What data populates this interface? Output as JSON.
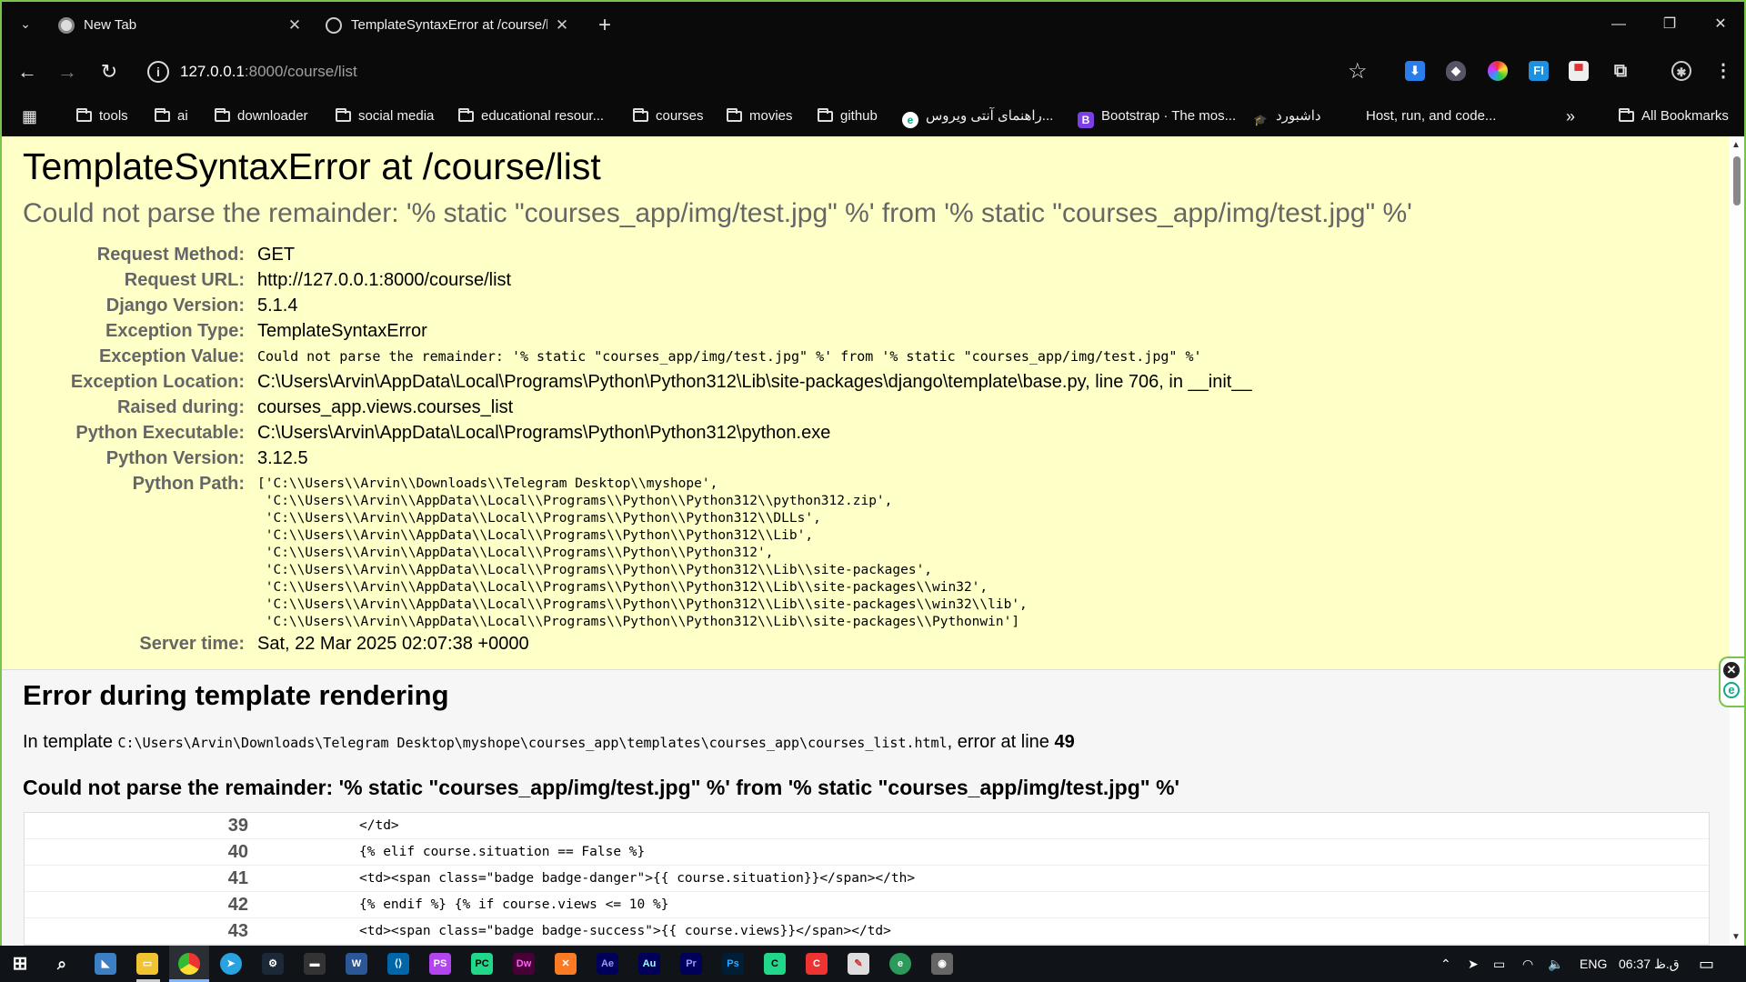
{
  "browser": {
    "tabs": [
      {
        "title": "New Tab"
      },
      {
        "title": "TemplateSyntaxError at /course/list"
      }
    ],
    "url_host": "127.0.0.1",
    "url_rest": ":8000/course/list",
    "bookmarks": [
      {
        "label": "tools",
        "type": "folder"
      },
      {
        "label": "ai",
        "type": "folder"
      },
      {
        "label": "downloader",
        "type": "folder"
      },
      {
        "label": "social media",
        "type": "folder"
      },
      {
        "label": "educational resour...",
        "type": "folder"
      },
      {
        "label": "courses",
        "type": "folder"
      },
      {
        "label": "movies",
        "type": "folder"
      },
      {
        "label": "github",
        "type": "folder"
      },
      {
        "label": "راهنمای آنتی ویروس...",
        "type": "site"
      },
      {
        "label": "Bootstrap · The mos...",
        "type": "site"
      },
      {
        "label": "داشبورد",
        "type": "site"
      },
      {
        "label": "Host, run, and code...",
        "type": "site"
      }
    ],
    "all_bookmarks": "All Bookmarks"
  },
  "error": {
    "title": "TemplateSyntaxError at /course/list",
    "subtitle": "Could not parse the remainder: '% static \"courses_app/img/test.jpg\" %' from '% static \"courses_app/img/test.jpg\" %'",
    "meta": [
      {
        "key": "Request Method:",
        "value": "GET"
      },
      {
        "key": "Request URL:",
        "value": "http://127.0.0.1:8000/course/list"
      },
      {
        "key": "Django Version:",
        "value": "5.1.4"
      },
      {
        "key": "Exception Type:",
        "value": "TemplateSyntaxError"
      },
      {
        "key": "Exception Value:",
        "value": "Could not parse the remainder: '% static \"courses_app/img/test.jpg\" %' from '% static \"courses_app/img/test.jpg\" %'"
      },
      {
        "key": "Exception Location:",
        "value": "C:\\Users\\Arvin\\AppData\\Local\\Programs\\Python\\Python312\\Lib\\site-packages\\django\\template\\base.py, line 706, in __init__"
      },
      {
        "key": "Raised during:",
        "value": "courses_app.views.courses_list"
      },
      {
        "key": "Python Executable:",
        "value": "C:\\Users\\Arvin\\AppData\\Local\\Programs\\Python\\Python312\\python.exe"
      },
      {
        "key": "Python Version:",
        "value": "3.12.5"
      }
    ],
    "python_path_label": "Python Path:",
    "python_path": [
      "['C:\\\\Users\\\\Arvin\\\\Downloads\\\\Telegram Desktop\\\\myshope',",
      " 'C:\\\\Users\\\\Arvin\\\\AppData\\\\Local\\\\Programs\\\\Python\\\\Python312\\\\python312.zip',",
      " 'C:\\\\Users\\\\Arvin\\\\AppData\\\\Local\\\\Programs\\\\Python\\\\Python312\\\\DLLs',",
      " 'C:\\\\Users\\\\Arvin\\\\AppData\\\\Local\\\\Programs\\\\Python\\\\Python312\\\\Lib',",
      " 'C:\\\\Users\\\\Arvin\\\\AppData\\\\Local\\\\Programs\\\\Python\\\\Python312',",
      " 'C:\\\\Users\\\\Arvin\\\\AppData\\\\Local\\\\Programs\\\\Python\\\\Python312\\\\Lib\\\\site-packages',",
      " 'C:\\\\Users\\\\Arvin\\\\AppData\\\\Local\\\\Programs\\\\Python\\\\Python312\\\\Lib\\\\site-packages\\\\win32',",
      " 'C:\\\\Users\\\\Arvin\\\\AppData\\\\Local\\\\Programs\\\\Python\\\\Python312\\\\Lib\\\\site-packages\\\\win32\\\\lib',",
      " 'C:\\\\Users\\\\Arvin\\\\AppData\\\\Local\\\\Programs\\\\Python\\\\Python312\\\\Lib\\\\site-packages\\\\Pythonwin']"
    ],
    "server_time_label": "Server time:",
    "server_time": "Sat, 22 Mar 2025 02:07:38 +0000"
  },
  "template": {
    "title": "Error during template rendering",
    "in_template_prefix": "In template",
    "template_path": "C:\\Users\\Arvin\\Downloads\\Telegram Desktop\\myshope\\courses_app\\templates\\courses_app\\courses_list.html",
    "error_at_line_text": ", error at line",
    "error_line": "49",
    "message": "Could not parse the remainder: '% static \"courses_app/img/test.jpg\" %' from '% static \"courses_app/img/test.jpg\" %'",
    "code_lines": [
      {
        "num": "39",
        "src": "</td>"
      },
      {
        "num": "40",
        "src": "{% elif course.situation == False %}"
      },
      {
        "num": "41",
        "src": "<td><span class=\"badge badge-danger\">{{ course.situation}}</span></th>"
      },
      {
        "num": "42",
        "src": "{% endif %} {% if course.views <= 10 %}"
      },
      {
        "num": "43",
        "src": "<td><span class=\"badge badge-success\">{{ course.views}}</span></td>"
      }
    ]
  },
  "taskbar": {
    "language": "ENG",
    "time": "06:37 ق.ظ"
  },
  "colors": {
    "summary_bg": "#ffffc8",
    "frame_accent": "#79c44a",
    "chrome_bg": "#0a0a0a"
  }
}
